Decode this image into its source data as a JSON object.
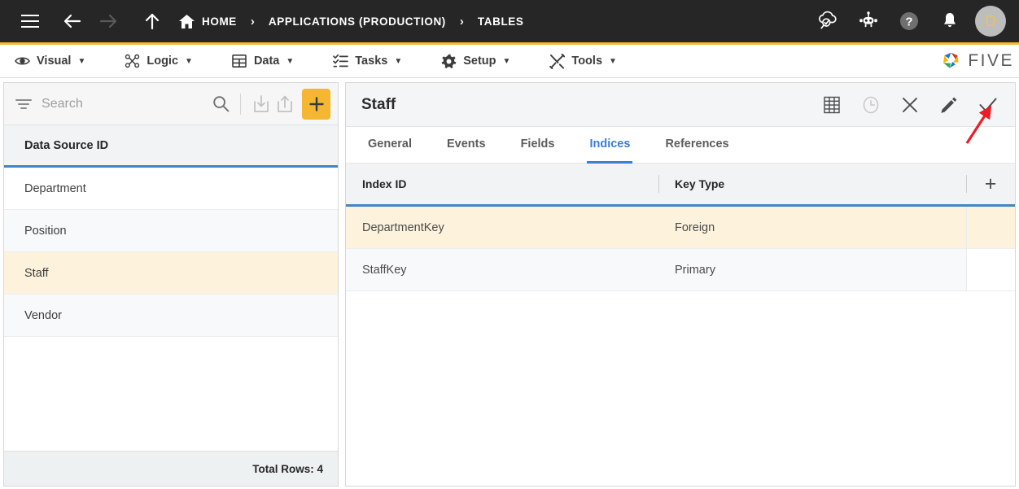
{
  "topbar": {
    "menu_icon": "hamburger-icon",
    "back_icon": "arrow-left-icon",
    "forward_icon": "arrow-right-icon",
    "up_icon": "arrow-up-icon",
    "home_icon": "home-icon",
    "breadcrumbs": [
      {
        "label": "HOME",
        "has_home_icon": true
      },
      {
        "label": "APPLICATIONS (PRODUCTION)",
        "has_home_icon": false
      },
      {
        "label": "TABLES",
        "has_home_icon": false
      }
    ],
    "separator": "›",
    "right_icons": [
      "cloud-search-icon",
      "chatbot-icon",
      "help-icon",
      "notification-bell-icon"
    ],
    "avatar_initial": "D",
    "bar_bg": "#262626",
    "accent": "#F5B731"
  },
  "menubar": {
    "items": [
      {
        "label": "Visual",
        "icon": "eye-icon",
        "caret": "▼"
      },
      {
        "label": "Logic",
        "icon": "logic-nodes-icon",
        "caret": "▼"
      },
      {
        "label": "Data",
        "icon": "table-grid-icon",
        "caret": "▼"
      },
      {
        "label": "Tasks",
        "icon": "checklist-icon",
        "caret": "▼"
      },
      {
        "label": "Setup",
        "icon": "gear-icon",
        "caret": "▼"
      },
      {
        "label": "Tools",
        "icon": "tools-wrench-icon",
        "caret": "▼"
      }
    ],
    "brand": "FIVE"
  },
  "sidebar": {
    "search": {
      "placeholder": "Search",
      "value": ""
    },
    "filter_icon": "filter-icon",
    "search_icon": "search-icon",
    "import_icon": "import-download-icon",
    "export_icon": "export-upload-icon",
    "add_icon": "plus-icon",
    "column_header": "Data Source ID",
    "rows": [
      {
        "label": "Department",
        "selected": false
      },
      {
        "label": "Position",
        "selected": false
      },
      {
        "label": "Staff",
        "selected": true
      },
      {
        "label": "Vendor",
        "selected": false
      }
    ],
    "footer": "Total Rows: 4"
  },
  "main": {
    "title": "Staff",
    "actions": [
      {
        "name": "grid-view-icon",
        "disabled": false
      },
      {
        "name": "history-clock-icon",
        "disabled": true
      },
      {
        "name": "close-x-icon",
        "disabled": false
      },
      {
        "name": "edit-pencil-icon",
        "disabled": false
      },
      {
        "name": "save-check-icon",
        "disabled": false
      }
    ],
    "tabs": [
      {
        "label": "General",
        "active": false
      },
      {
        "label": "Events",
        "active": false
      },
      {
        "label": "Fields",
        "active": false
      },
      {
        "label": "Indices",
        "active": true
      },
      {
        "label": "References",
        "active": false
      }
    ],
    "grid": {
      "columns": [
        "Index ID",
        "Key Type"
      ],
      "add_column_label": "+",
      "rows": [
        {
          "index_id": "DepartmentKey",
          "key_type": "Foreign",
          "selected": true
        },
        {
          "index_id": "StaffKey",
          "key_type": "Primary",
          "selected": false
        }
      ]
    }
  },
  "annotation": {
    "type": "arrow",
    "color": "#EE1C25",
    "points_to": "save-check-icon"
  }
}
